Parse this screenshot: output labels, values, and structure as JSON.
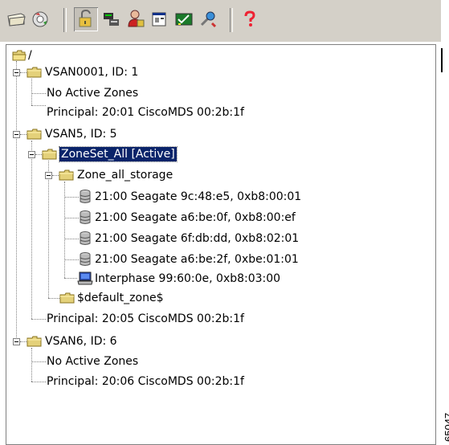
{
  "toolbar": {
    "buttons": [
      {
        "icon": "open-icon"
      },
      {
        "icon": "gear-disc-icon"
      },
      {
        "icon": "lock-icon"
      },
      {
        "icon": "switch-icon"
      },
      {
        "icon": "user-lock-icon"
      },
      {
        "icon": "properties-icon"
      },
      {
        "icon": "check-chart-icon"
      },
      {
        "icon": "tools-icon"
      },
      {
        "icon": "help-icon"
      }
    ]
  },
  "tree": {
    "root": "/",
    "vsan1": {
      "label": "VSAN0001, ID: 1",
      "no_zones": "No Active Zones",
      "principal": "Principal: 20:01 CiscoMDS 00:2b:1f"
    },
    "vsan5": {
      "label": "VSAN5, ID: 5",
      "zoneset": "ZoneSet_All [Active]",
      "zone": "Zone_all_storage",
      "members": [
        "21:00 Seagate 9c:48:e5, 0xb8:00:01",
        "21:00 Seagate a6:be:0f, 0xb8:00:ef",
        "21:00 Seagate 6f:db:dd, 0xb8:02:01",
        "21:00 Seagate a6:be:2f, 0xbe:01:01",
        "Interphase 99:60:0e, 0xb8:03:00"
      ],
      "default_zone": "$default_zone$",
      "principal": "Principal: 20:05 CiscoMDS 00:2b:1f"
    },
    "vsan6": {
      "label": "VSAN6, ID: 6",
      "no_zones": "No Active Zones",
      "principal": "Principal: 20:06 CiscoMDS 00:2b:1f"
    }
  },
  "figure_id": "65047"
}
